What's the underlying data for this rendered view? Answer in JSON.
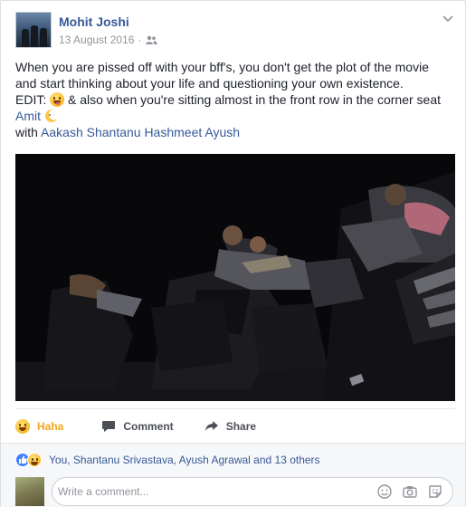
{
  "post": {
    "author": "Mohit Joshi",
    "date": "13 August 2016",
    "separator": "·",
    "text_line1": "When you are pissed off with your bff's, you don't get the plot of the movie",
    "text_line2": "and start thinking about your life and questioning your own existence.",
    "edit_label": "EDIT:",
    "edit_text": "& also when you're sitting almost in the front row in the corner seat",
    "edit_mention": "Amit",
    "with_label": "with",
    "tagged": "Aakash Shantanu Hashmeet Ayush"
  },
  "actions": {
    "haha_label": "Haha",
    "comment_label": "Comment",
    "share_label": "Share"
  },
  "reactions": {
    "summary": "You, Shantanu Srivastava, Ayush Agrawal and 13 others"
  },
  "comment_box": {
    "placeholder": "Write a comment..."
  },
  "icons": {
    "audience": "friends-icon",
    "options": "chevron-down-icon",
    "haha": "haha-emoji-icon",
    "comment": "comment-bubble-icon",
    "share": "share-arrow-icon",
    "like": "like-icon",
    "emoji_picker": "emoji-icon",
    "camera": "camera-icon",
    "sticker": "sticker-icon"
  },
  "colors": {
    "link": "#365899",
    "haha": "#f0a71b",
    "like": "#4080ff"
  }
}
